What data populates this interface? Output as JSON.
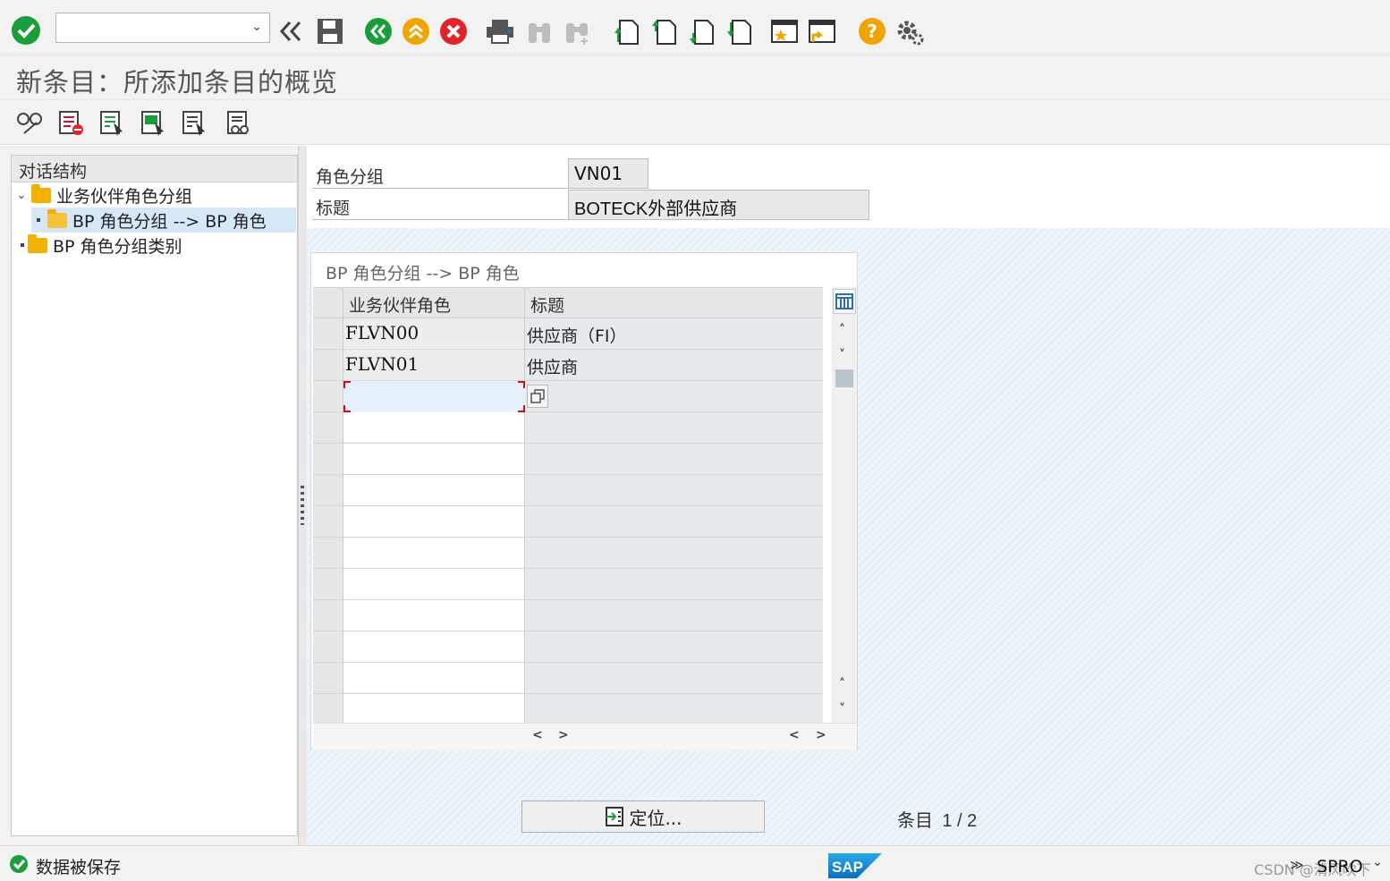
{
  "toolbar": {
    "command_field_value": "",
    "colors": {
      "green": "#1a9d3a",
      "orange": "#f0a400",
      "red": "#e0242a"
    }
  },
  "page": {
    "title": "新条目：所添加条目的概览"
  },
  "tree": {
    "header": "对话结构",
    "items": [
      {
        "label": "业务伙伴角色分组",
        "icon": "folder-icon"
      },
      {
        "label": "BP 角色分组 --> BP 角色",
        "icon": "folder-open-icon"
      },
      {
        "label": "BP 角色分组类别",
        "icon": "folder-icon"
      }
    ]
  },
  "form": {
    "role_group_label": "角色分组",
    "role_group_value": "VN01",
    "title_label": "标题",
    "title_value": "BOTECK外部供应商"
  },
  "table": {
    "title": "BP 角色分组 --> BP 角色",
    "col_role": "业务伙伴角色",
    "col_title": "标题",
    "rows": [
      {
        "role": "FLVN00",
        "title": "供应商（FI）"
      },
      {
        "role": "FLVN01",
        "title": "供应商"
      }
    ]
  },
  "actions": {
    "position_button": "定位...",
    "entry_label": "条目",
    "entry_value": "1 / 2"
  },
  "status": {
    "message": "数据被保存",
    "tx_code": "SPRO",
    "watermark": "CSDN @清风吹下"
  }
}
